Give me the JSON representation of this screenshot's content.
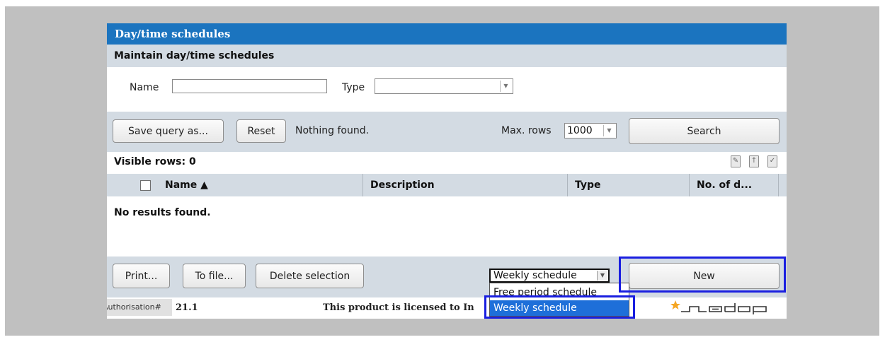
{
  "window": {
    "title": "Day/time schedules",
    "subtitle": "Maintain day/time schedules"
  },
  "filters": {
    "name_label": "Name",
    "name_value": "",
    "type_label": "Type",
    "type_value": ""
  },
  "toolbar": {
    "save_query_label": "Save query as...",
    "reset_label": "Reset",
    "status": "Nothing found.",
    "max_rows_label": "Max. rows",
    "max_rows_value": "1000",
    "search_label": "Search"
  },
  "grid": {
    "visible_rows_text": "Visible rows: 0",
    "columns": [
      "Name ▲",
      "Description",
      "Type",
      "No. of d..."
    ],
    "empty_message": "No results found."
  },
  "actions": {
    "print_label": "Print...",
    "to_file_label": "To file...",
    "delete_selection_label": "Delete selection",
    "schedule_type_value": "Weekly schedule",
    "schedule_type_options": [
      "Free period schedule",
      "Weekly schedule"
    ],
    "new_label": "New"
  },
  "footer": {
    "authorisation": "Authorisation#",
    "version": "21.1",
    "license": "This product is licensed to In",
    "brand": "nedap"
  },
  "colors": {
    "title_bar": "#1b74bf",
    "section_bg": "#d3dbe3",
    "highlight_box": "#1a1fe0",
    "selected_option": "#1e6fd9",
    "logo_star": "#f5a623"
  },
  "icons": [
    "edit-document-icon",
    "export-document-icon",
    "check-document-icon",
    "sort-ascending-icon",
    "dropdown-arrow-icon",
    "nedap-logo-icon"
  ]
}
